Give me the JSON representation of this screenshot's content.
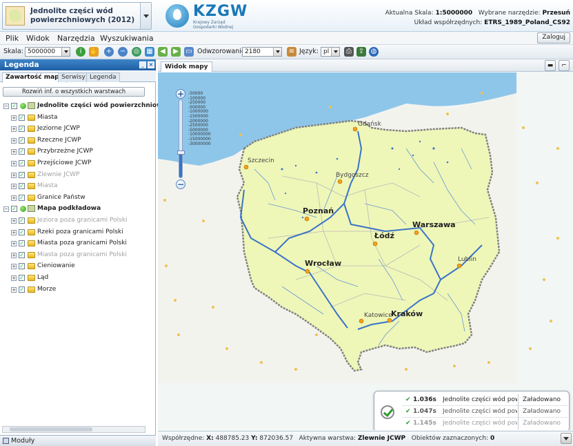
{
  "header": {
    "project_title": "Jednolite części wód powierzchniowych (2012)",
    "logo_text": "KZGW",
    "logo_sub": "Krajowy Zarząd Gospodarki Wodnej",
    "scale_label": "Aktualna Skala:",
    "scale_value": "1:5000000",
    "tool_label": "Wybrane narzędzie:",
    "tool_value": "Przesuń",
    "crs_label": "Układ współrzędnych:",
    "crs_value": "ETRS_1989_Poland_CS92"
  },
  "menu": {
    "items": [
      "Plik",
      "Widok",
      "Narzędzia",
      "Wyszukiwania"
    ],
    "login_label": "Zaloguj"
  },
  "toolbar": {
    "scale_label": "Skala:",
    "scale_value": "5000000",
    "dpi_label": "Odwzorowanie:",
    "dpi_value": "2180",
    "lang_label": "Język:",
    "lang_value": "pl"
  },
  "legend_panel": {
    "title": "Legenda",
    "tabs": [
      "Zawartość mapy",
      "Serwisy",
      "Legenda"
    ],
    "expand_button": "Rozwiń inf. o wszystkich warstwach",
    "groups": [
      {
        "label": "Jednolite części wód powierzchniowych (",
        "layers": [
          {
            "label": "Miasta",
            "dim": false
          },
          {
            "label": "Jeziorne JCWP",
            "dim": false
          },
          {
            "label": "Rzeczne JCWP",
            "dim": false
          },
          {
            "label": "Przybrzeżne JCWP",
            "dim": false
          },
          {
            "label": "Przejściowe JCWP",
            "dim": false
          },
          {
            "label": "Zlewnie JCWP",
            "dim": true
          },
          {
            "label": "Miasta",
            "dim": true
          },
          {
            "label": "Granice Państw",
            "dim": false
          }
        ]
      },
      {
        "label": "Mapa podkładowa",
        "layers": [
          {
            "label": "Jeziora poza granicami Polski",
            "dim": true
          },
          {
            "label": "Rzeki poza granicami Polski",
            "dim": false
          },
          {
            "label": "Miasta poza granicami Polski",
            "dim": false
          },
          {
            "label": "Miasta poza granicami Polski",
            "dim": true
          },
          {
            "label": "Cieniowanie",
            "dim": false
          },
          {
            "label": "Ląd",
            "dim": false
          },
          {
            "label": "Morze",
            "dim": false
          }
        ]
      }
    ],
    "modules_label": "Moduły"
  },
  "map_panel": {
    "tab_label": "Widok mapy",
    "scale_labels": [
      "-50000",
      "-100000",
      "-250000",
      "-500000",
      "-1000000",
      "-1500000",
      "-2000000",
      "-2500000",
      "-5000000",
      "-10000000",
      "-15000000",
      "-30000000"
    ],
    "zoom_level_fraction": 0.32,
    "cities": [
      {
        "name": "Gdańsk",
        "type": "small"
      },
      {
        "name": "Szczecin",
        "type": "small"
      },
      {
        "name": "Bydgoszcz",
        "type": "small"
      },
      {
        "name": "Poznań",
        "type": "big"
      },
      {
        "name": "Warszawa",
        "type": "big"
      },
      {
        "name": "Łódź",
        "type": "big"
      },
      {
        "name": "Wrocław",
        "type": "big"
      },
      {
        "name": "Lublin",
        "type": "small"
      },
      {
        "name": "Katowice",
        "type": "small"
      },
      {
        "name": "Kraków",
        "type": "big"
      }
    ],
    "colors": {
      "land": "#eef7b8",
      "sea": "#8ec6ea",
      "river": "#3a72c8",
      "border": "#808080",
      "city": "#f0a020"
    }
  },
  "load_panel": {
    "rows": [
      {
        "time": "1.036s",
        "name": "Jednolite części wód pow",
        "status": "Załadowano"
      },
      {
        "time": "1.047s",
        "name": "Jednolite części wód pow",
        "status": "Załadowano"
      },
      {
        "time": "1.145s",
        "name": "Jednolite części wód pow",
        "status": "Załadowano"
      }
    ]
  },
  "status": {
    "coords_label": "Współrzędne:",
    "x_label": "X:",
    "x_value": "488785.23",
    "y_label": "Y:",
    "y_value": "872036.57",
    "active_label": "Aktywna warstwa:",
    "active_value": "Zlewnie JCWP",
    "selected_label": "Obiektów zaznaczonych:",
    "selected_value": "0"
  }
}
